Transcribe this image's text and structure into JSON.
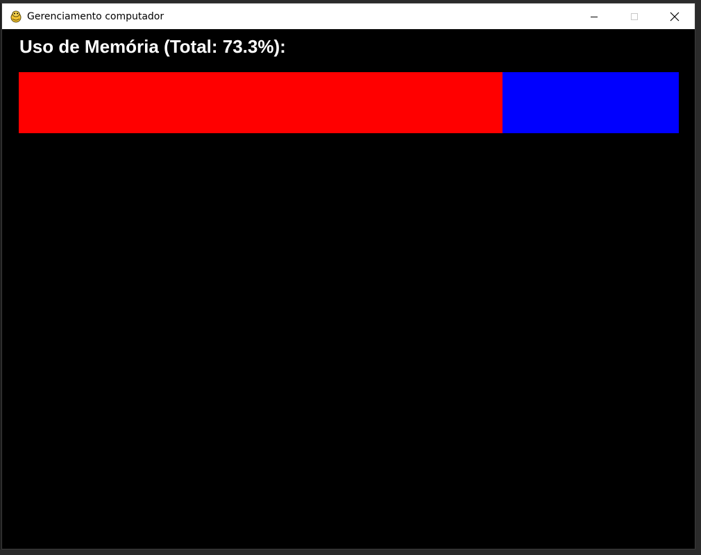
{
  "window": {
    "title": "Gerenciamento computador",
    "app_icon": "pygame-snake-icon",
    "controls": [
      "minimize-icon",
      "maximize-icon",
      "close-icon"
    ]
  },
  "memory": {
    "heading": "Uso de Memória (Total: 73.3%):",
    "used_percent": 73.3,
    "used_color": "#ff0000",
    "free_color": "#0000ff"
  },
  "colors": {
    "background": "#000000",
    "titlebar": "#ffffff",
    "heading_text": "#ffffff"
  }
}
